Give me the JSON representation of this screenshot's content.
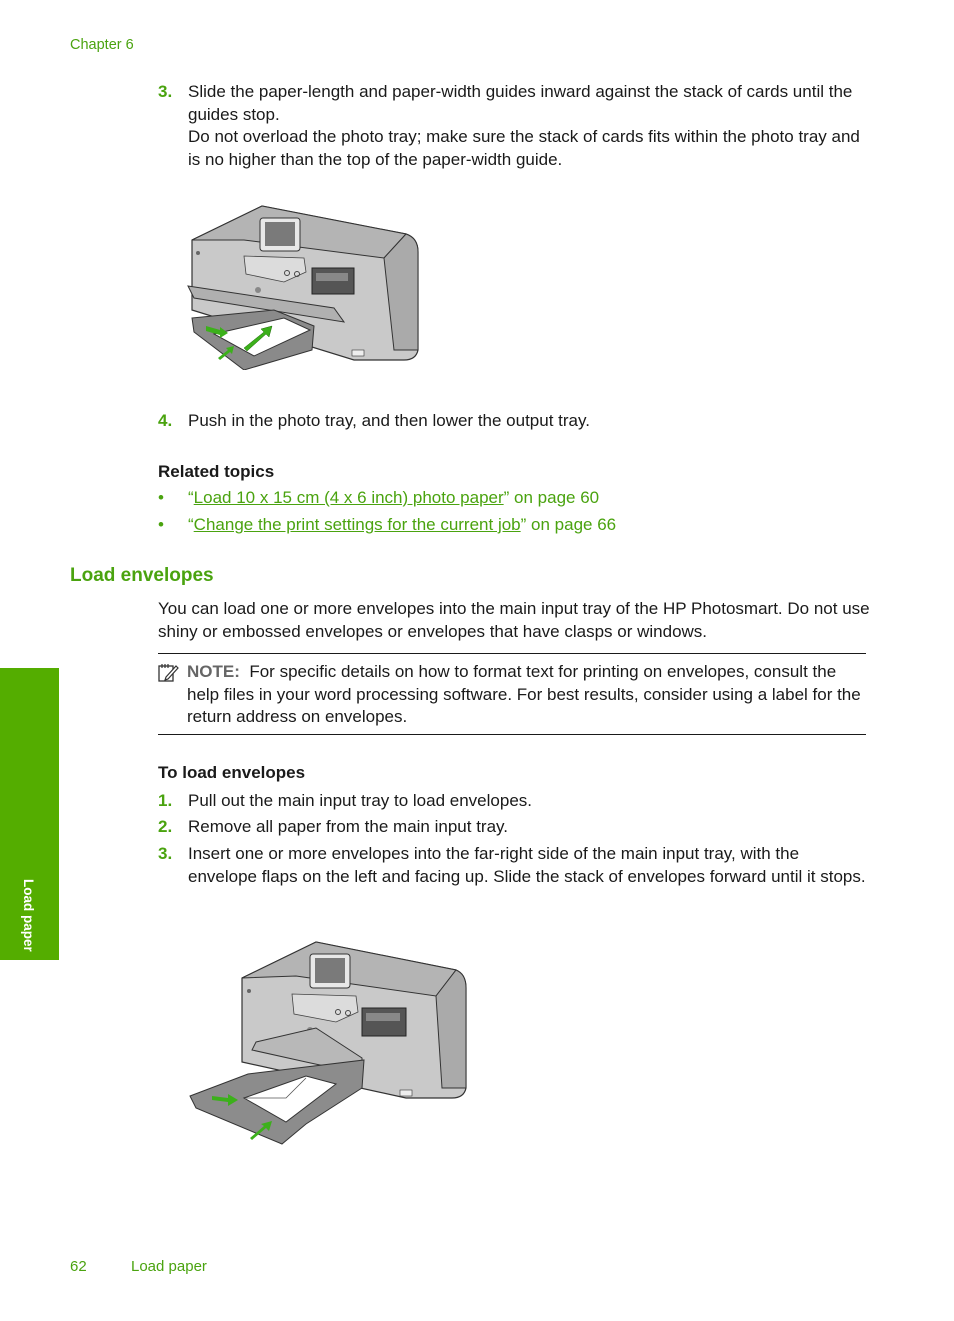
{
  "header": {
    "chapter": "Chapter 6"
  },
  "steps_top": [
    {
      "num": "3.",
      "lines": [
        "Slide the paper-length and paper-width guides inward against the stack of cards until the guides stop.",
        "Do not overload the photo tray; make sure the stack of cards fits within the photo tray and is no higher than the top of the paper-width guide."
      ]
    },
    {
      "num": "4.",
      "lines": [
        "Push in the photo tray, and then lower the output tray."
      ]
    }
  ],
  "figures": {
    "photo_tray": {
      "icon": "printer-photo-tray-illustration",
      "arrow_color": "#3cb01b"
    },
    "envelopes": {
      "icon": "printer-envelope-loading-illustration",
      "arrow_color": "#3cb01b"
    }
  },
  "related": {
    "title": "Related topics",
    "items": [
      {
        "bullet": "•",
        "open_quote": "“",
        "link": "Load 10 x 15 cm (4 x 6 inch) photo paper",
        "suffix": "” on page 60"
      },
      {
        "bullet": "•",
        "open_quote": "“",
        "link": "Change the print settings for the current job",
        "suffix": "” on page 66"
      }
    ]
  },
  "section": {
    "title": "Load envelopes",
    "intro": "You can load one or more envelopes into the main input tray of the HP Photosmart. Do not use shiny or embossed envelopes or envelopes that have clasps or windows.",
    "note": {
      "icon": "note-pencil-icon",
      "label": "NOTE:",
      "text": "For specific details on how to format text for printing on envelopes, consult the help files in your word processing software. For best results, consider using a label for the return address on envelopes."
    },
    "procedure_title": "To load envelopes",
    "steps": [
      {
        "num": "1.",
        "text": "Pull out the main input tray to load envelopes."
      },
      {
        "num": "2.",
        "text": "Remove all paper from the main input tray."
      },
      {
        "num": "3.",
        "text": "Insert one or more envelopes into the far-right side of the main input tray, with the envelope flaps on the left and facing up. Slide the stack of envelopes forward until it stops."
      }
    ]
  },
  "side_tab": {
    "label": "Load paper",
    "color": "#54ad00"
  },
  "footer": {
    "page_number": "62",
    "section": "Load paper"
  },
  "colors": {
    "accent": "#4aa30f",
    "text": "#1a1a1a"
  }
}
